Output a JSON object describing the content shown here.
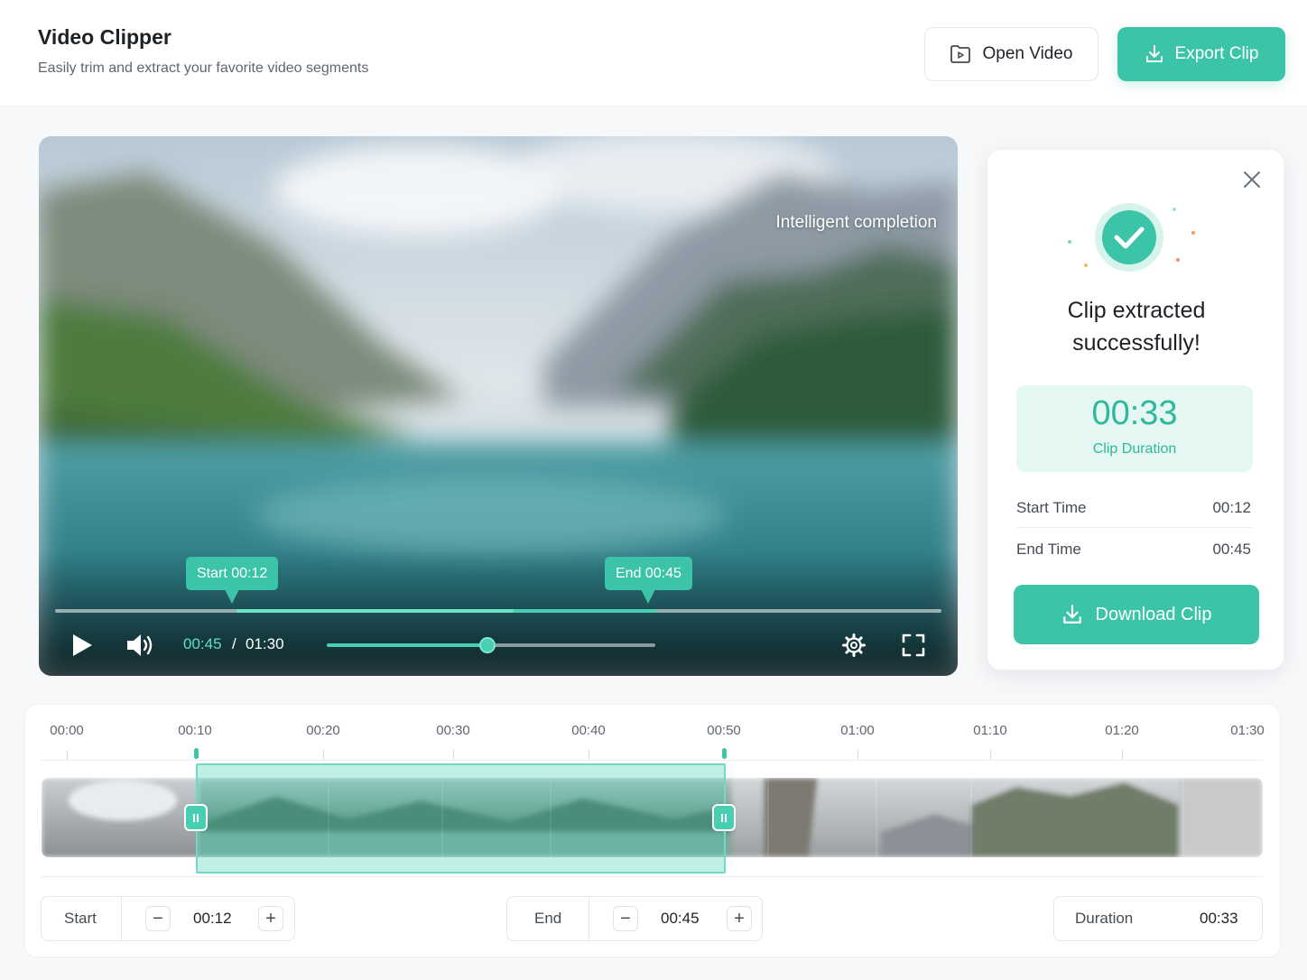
{
  "header": {
    "title": "Video Clipper",
    "subtitle": "Easily trim and extract your favorite video segments",
    "open_label": "Open Video",
    "export_label": "Export Clip"
  },
  "player": {
    "overlay_text": "Intelligent completion",
    "start_tag": "Start 00:12",
    "end_tag": "End 00:45",
    "current_time": "00:45",
    "separator": "/",
    "total_time": "01:30",
    "volume_level": 0.49,
    "playhead_fraction": 0.56
  },
  "result": {
    "title_line1": "Clip extracted",
    "title_line2": "successfully!",
    "duration_value": "00:33",
    "duration_label": "Clip Duration",
    "start_label": "Start Time",
    "start_value": "00:12",
    "end_label": "End Time",
    "end_value": "00:45",
    "download_label": "Download Clip"
  },
  "timeline": {
    "ticks": [
      "00:00",
      "00:10",
      "00:20",
      "00:30",
      "00:40",
      "00:50",
      "01:00",
      "01:10",
      "01:20",
      "01:30"
    ],
    "start": {
      "label": "Start",
      "value": "00:12",
      "minus": "−",
      "plus": "+"
    },
    "end": {
      "label": "End",
      "value": "00:45",
      "minus": "−",
      "plus": "+"
    },
    "duration": {
      "label": "Duration",
      "value": "00:33"
    }
  },
  "colors": {
    "accent": "#3cc4a8",
    "accent_light": "#e4f7f2",
    "text": "#1f2328"
  }
}
